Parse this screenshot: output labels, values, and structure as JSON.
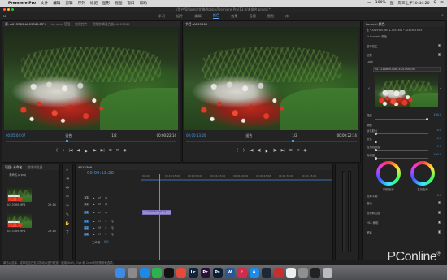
{
  "menubar": {
    "app": "Premiere Pro",
    "items": [
      "文件",
      "编辑",
      "剪辑",
      "序列",
      "标记",
      "图形",
      "视图",
      "窗口",
      "帮助"
    ],
    "status_right": [
      "一",
      "100%",
      "图",
      "周三上午10:44:20",
      "Q",
      "≡"
    ]
  },
  "titlebar": {
    "path": "/用户/Shiomo/文稿/Adobe/Premiere Pro/13.0/未命名.prproj *"
  },
  "workspace": {
    "tabs": [
      "学习",
      "组件",
      "编辑",
      "颜色",
      "效果",
      "音频",
      "图形",
      "库"
    ],
    "active": "颜色"
  },
  "source_panel": {
    "tabs": [
      "源: A015369 A015369.MP4",
      "Lumetri 范围",
      "效果控件",
      "音频剪辑混合器: A015369"
    ],
    "timecode_left": "00:05:04:07",
    "fit": "适合",
    "ratio": "1/2",
    "timecode_right": "00:00:22:14"
  },
  "program_panel": {
    "tab": "节目: A015369",
    "timecode_left": "00:00:13:20",
    "fit": "适合",
    "ratio": "1/2",
    "timecode_right": "00:00:22:14"
  },
  "transport_icons": [
    "{",
    "}",
    "|◀",
    "◀|",
    "▶",
    "|▶",
    "▶|",
    "⊞",
    "⊡",
    "◉"
  ],
  "project_panel": {
    "tabs": [
      "项目: 未命名",
      "媒体浏览器"
    ],
    "file": "未命名.prproj",
    "items": [
      {
        "name": "A015369.MP4",
        "duration": "22:14"
      },
      {
        "name": "A015369.MP4",
        "duration": "22:14"
      }
    ]
  },
  "timeline": {
    "tab": "A015369",
    "timecode": "00:00:13:20",
    "ruler": [
      "00:00",
      "00:00:15:00",
      "00:00:30:00",
      "00:00:45:00",
      "00:01:00:00",
      "00:01:15:00",
      "00:01:30:00",
      "00:01:45:00"
    ],
    "tracks": [
      {
        "id": "V3",
        "kind": "video"
      },
      {
        "id": "V2",
        "kind": "video"
      },
      {
        "id": "V1",
        "kind": "video"
      },
      {
        "id": "A1",
        "kind": "audio"
      },
      {
        "id": "A2",
        "kind": "audio"
      },
      {
        "id": "A3",
        "kind": "audio"
      }
    ],
    "master": {
      "label": "主声道",
      "value": "0.0"
    },
    "clip_label": "fx A015369.MP4 [V]"
  },
  "lumetri": {
    "title": "Lumetri 颜色",
    "source_row": "主 * A015369.MP4 ▸ A015369 * A015369.MP4",
    "fx_label": "fx  Lumetri 颜色",
    "sections": {
      "basic": "基本校正",
      "creative": "创意",
      "curves": "曲线",
      "color_wheels": "色轮和匹配",
      "hsl": "HSL 辅助",
      "vignette": "晕影"
    },
    "look_label": "Look",
    "look_value": "SL CLEAN KODAK 8 ULTRASOFT",
    "intensity": {
      "label": "强度",
      "value": "100.0"
    },
    "adjust_label": "调整",
    "sliders": [
      {
        "label": "淡化胶片",
        "value": "0.0",
        "fraction": 0.0
      },
      {
        "label": "锐化",
        "value": "0.0",
        "fraction": 0.5
      },
      {
        "label": "自然饱和度",
        "value": "0.0",
        "fraction": 0.5
      },
      {
        "label": "饱和度",
        "value": "100.0",
        "fraction": 0.5
      }
    ],
    "wheel_labels": [
      "阴影色彩",
      "高光色彩"
    ],
    "tint_balance": {
      "label": "色彩平衡",
      "value": "0.0"
    }
  },
  "status_bar": {
    "text": "单击以选择，或单击空白处并拖动以进行框选。使用 Shift、Opt 和 Cmd 可获得其他选项。"
  },
  "dock": {
    "icons": [
      {
        "name": "finder",
        "label": "",
        "color": "#3c8ce7"
      },
      {
        "name": "launchpad",
        "label": "",
        "color": "#8a8a8a"
      },
      {
        "name": "safari",
        "label": "",
        "color": "#1e88e5"
      },
      {
        "name": "wechat",
        "label": "",
        "color": "#2bb24c"
      },
      {
        "name": "qq",
        "label": "",
        "color": "#111"
      },
      {
        "name": "chrome",
        "label": "",
        "color": "#e54b3b"
      },
      {
        "name": "lightroom",
        "label": "Lr",
        "color": "#0f2236"
      },
      {
        "name": "premiere",
        "label": "Pr",
        "color": "#2a0f3a"
      },
      {
        "name": "photoshop",
        "label": "Ps",
        "color": "#0b1e33"
      },
      {
        "name": "wps",
        "label": "W",
        "color": "#2b5797"
      },
      {
        "name": "music",
        "label": "♪",
        "color": "#d02c4d"
      },
      {
        "name": "app-store",
        "label": "A",
        "color": "#1a8cf0"
      },
      {
        "name": "steam",
        "label": "",
        "color": "#1b2838"
      },
      {
        "name": "netease",
        "label": "",
        "color": "#c62f2f"
      },
      {
        "name": "photos",
        "label": "",
        "color": "#eee"
      },
      {
        "name": "settings",
        "label": "",
        "color": "#8f8f8f"
      },
      {
        "name": "terminal",
        "label": "",
        "color": "#222"
      },
      {
        "name": "trash",
        "label": "",
        "color": "#bbb"
      }
    ]
  },
  "watermark": {
    "text": "PConline",
    "mark": "®"
  },
  "colors": {
    "accent": "#4a9ce0",
    "clip": "#9b8fd1"
  }
}
